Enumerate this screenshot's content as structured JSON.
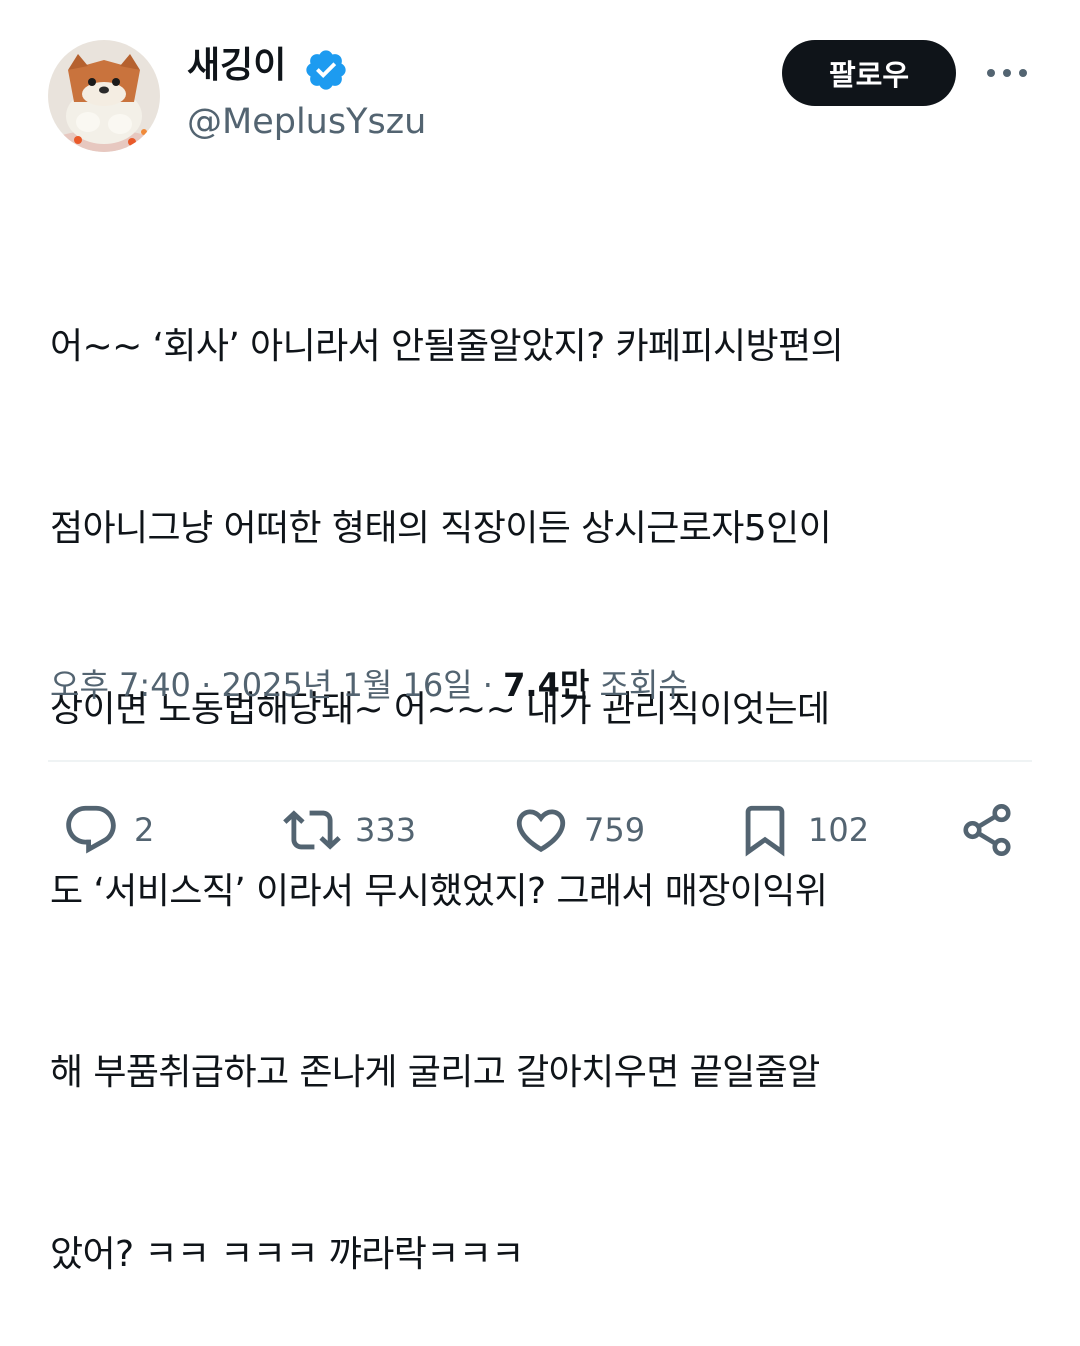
{
  "author": {
    "display_name": "새깅이",
    "handle": "@MeplusYszu",
    "verified": true,
    "avatar_icon": "plush-toy-avatar",
    "verified_icon": "verified-badge-icon",
    "verified_color": "#1d9bf0"
  },
  "header": {
    "follow_label": "팔로우",
    "more_icon": "more-icon"
  },
  "tweet": {
    "lines": [
      "어~~ ‘회사’ 아니라서 안될줄알았지? 카페피시방편의",
      "점아니그냥 어떠한 형태의 직장이든 상시근로자5인이",
      "상이면 노동법해당돼~ 어~~~ 내가 관리직이엇는데",
      "도 ‘서비스직’ 이라서 무시했었지? 그래서 매장이익위",
      "해 부품취급하고 존나게 굴리고 갈아치우면 끝일줄알",
      "았어? ㅋㅋ ㅋㅋㅋ 꺄라락ㅋㅋㅋ"
    ]
  },
  "meta": {
    "time": "오후 7:40",
    "separator": " · ",
    "date": "2025년 1월 16일",
    "views_count": "7.4만",
    "views_label": "조회수"
  },
  "actions": {
    "reply": {
      "icon": "reply-icon",
      "count": "2"
    },
    "retweet": {
      "icon": "retweet-icon",
      "count": "333"
    },
    "like": {
      "icon": "heart-icon",
      "count": "759"
    },
    "bookmark": {
      "icon": "bookmark-icon",
      "count": "102"
    },
    "share": {
      "icon": "share-icon"
    }
  },
  "colors": {
    "text_primary": "#0f1419",
    "text_secondary": "#536471",
    "follow_button_bg": "#0f1419",
    "follow_button_text": "#ffffff",
    "divider": "#eff3f4"
  }
}
